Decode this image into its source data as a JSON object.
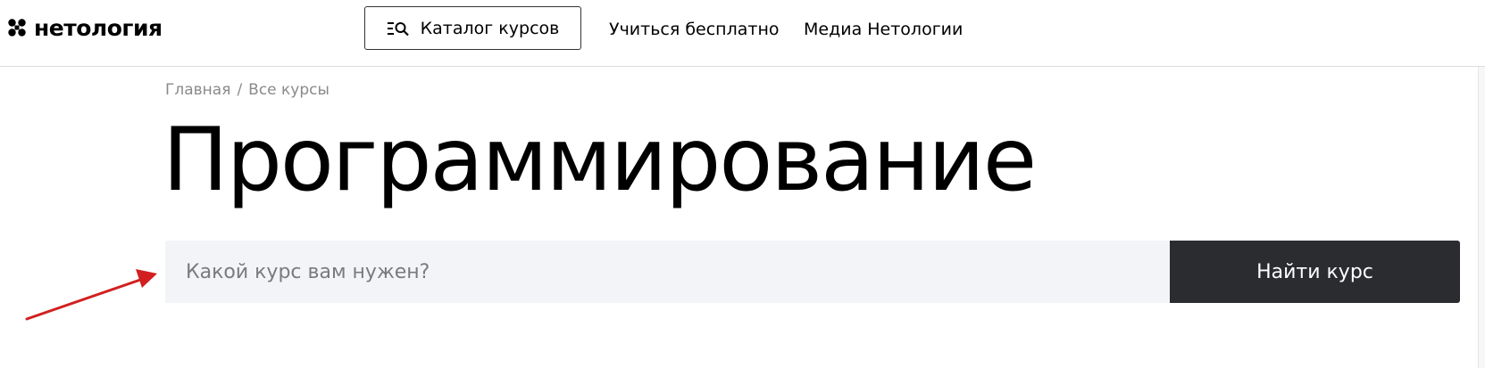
{
  "header": {
    "logo_text": "нетология",
    "catalog_label": "Каталог курсов",
    "nav": {
      "learn_free": "Учиться бесплатно",
      "media": "Медиа Нетологии"
    }
  },
  "breadcrumb": {
    "home": "Главная",
    "separator": "/",
    "all_courses": "Все курсы"
  },
  "page_title": "Программирование",
  "search": {
    "placeholder": "Какой курс вам нужен?",
    "value": "",
    "button_label": "Найти курс"
  },
  "colors": {
    "search_bg": "#f3f4f7",
    "button_bg": "#2b2c30",
    "breadcrumb_text": "#8a8a8a",
    "annotation_arrow": "#d21f1f"
  },
  "icons": {
    "logo": "netology-logo-icon",
    "catalog": "catalog-search-icon",
    "annotation": "red-arrow-icon"
  }
}
